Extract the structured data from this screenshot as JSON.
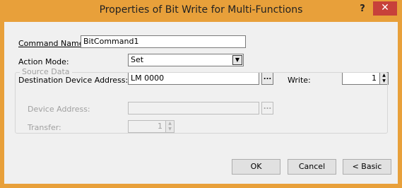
{
  "window": {
    "title": "Properties of Bit Write for Multi-Functions",
    "help_label": "?",
    "close_label": "✕"
  },
  "form": {
    "command_name": {
      "label": "Command Name:",
      "value": "BitCommand1"
    },
    "action_mode": {
      "label": "Action Mode:",
      "value": "Set"
    },
    "destination": {
      "label": "Destination Device Address:",
      "value": "LM 0000",
      "browse": "..."
    },
    "write": {
      "label": "Write:",
      "value": "1"
    }
  },
  "source_data": {
    "legend": "Source Data",
    "device_address": {
      "label": "Device Address:",
      "value": "",
      "browse": "..."
    },
    "transfer": {
      "label": "Transfer:",
      "value": "1"
    }
  },
  "buttons": {
    "ok": "OK",
    "cancel": "Cancel",
    "basic": "< Basic"
  },
  "colors": {
    "titlebar": "#e8a03a",
    "close": "#c7413a"
  },
  "icons": {
    "help": "help-icon",
    "close": "close-icon",
    "dropdown": "chevron-down-icon"
  }
}
